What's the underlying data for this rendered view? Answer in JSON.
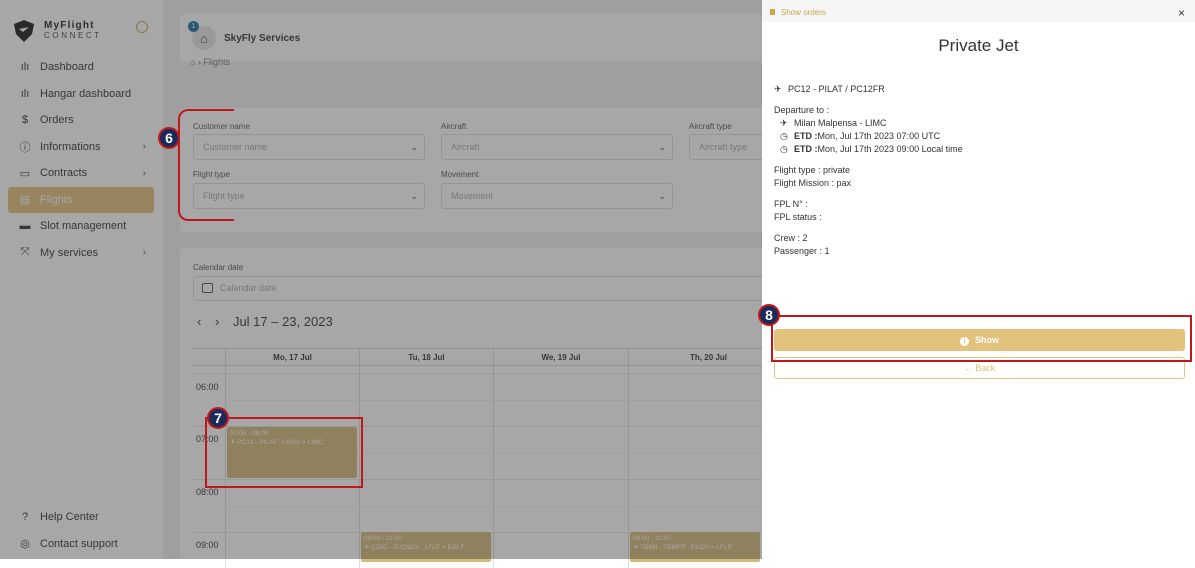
{
  "app": {
    "logo_line1": "MyFlight",
    "logo_line2": "CONNECT"
  },
  "sidebar": {
    "items": [
      {
        "label": "Dashboard",
        "icon": "bar-chart-icon"
      },
      {
        "label": "Hangar dashboard",
        "icon": "bar-chart-icon"
      },
      {
        "label": "Orders",
        "icon": "dollar-icon"
      },
      {
        "label": "Informations",
        "icon": "info-icon"
      },
      {
        "label": "Contracts",
        "icon": "folder-icon"
      },
      {
        "label": "Flights",
        "icon": "briefcase-icon"
      },
      {
        "label": "Slot management",
        "icon": "printer-icon"
      },
      {
        "label": "My services",
        "icon": "tools-icon"
      }
    ],
    "bottom": [
      {
        "label": "Help Center",
        "icon": "question-icon"
      },
      {
        "label": "Contact support",
        "icon": "lifebuoy-icon"
      }
    ]
  },
  "header": {
    "company": "SkyFly Services",
    "notification_count": "1"
  },
  "breadcrumb": {
    "current": "Flights"
  },
  "filters": {
    "customer_label": "Customer name",
    "customer_placeholder": "Customer name",
    "aircraft_label": "Aircraft",
    "aircraft_placeholder": "Aircraft",
    "aircraft_type_label": "Aircraft type",
    "aircraft_type_placeholder": "Aircraft type",
    "flight_type_label": "Flight type",
    "flight_type_placeholder": "Flight type",
    "movement_label": "Movement",
    "movement_placeholder": "Movement"
  },
  "calendar": {
    "date_label": "Calendar date",
    "date_placeholder": "Calendar date",
    "range": "Jul 17 – 23, 2023",
    "days": [
      "Mo, 17 Jul",
      "Tu, 18 Jul",
      "We, 19 Jul",
      "Th, 20 Jul"
    ],
    "hours": [
      "06:00",
      "07:00",
      "08:00",
      "09:00"
    ],
    "events": [
      {
        "time": "07:00 - 08:00",
        "title": "✈ PC12 - PILAT : LSGG > LIMC"
      },
      {
        "time": "09:00 - 11:00",
        "title": "✈ C25C - D-CNOX : LFLP > EGLF"
      },
      {
        "time": "09:00 - 11:00",
        "title": "✈ TBM9 - TBMFR : EKCH > LFLP"
      }
    ]
  },
  "annotations": {
    "a6": "6",
    "a7": "7",
    "a8": "8"
  },
  "panel": {
    "show_orders": "Show orders",
    "close": "×",
    "title": "Private Jet",
    "aircraft": "PC12 - PILAT / PC12FR",
    "departure_label": "Departure to :",
    "destination": "Milan Malpensa - LIMC",
    "etd_utc_label": "ETD :",
    "etd_utc": "Mon, Jul 17th 2023 07:00 UTC",
    "etd_local_label": "ETD :",
    "etd_local": "Mon, Jul 17th 2023 09:00 Local time",
    "flight_type_label": "Flight type :",
    "flight_type": "private",
    "mission_label": "Flight Mission :",
    "mission": "pax",
    "fpl_no_label": "FPL N° :",
    "fpl_status_label": "FPL status :",
    "crew_label": "Crew :",
    "crew": "2",
    "passenger_label": "Passenger :",
    "passenger": "1",
    "show_button": "Show",
    "back_button": "Back"
  },
  "colors": {
    "accent": "#e2c27c",
    "annotation_red": "#c0181a",
    "annotation_navy": "#1a2a5a"
  }
}
